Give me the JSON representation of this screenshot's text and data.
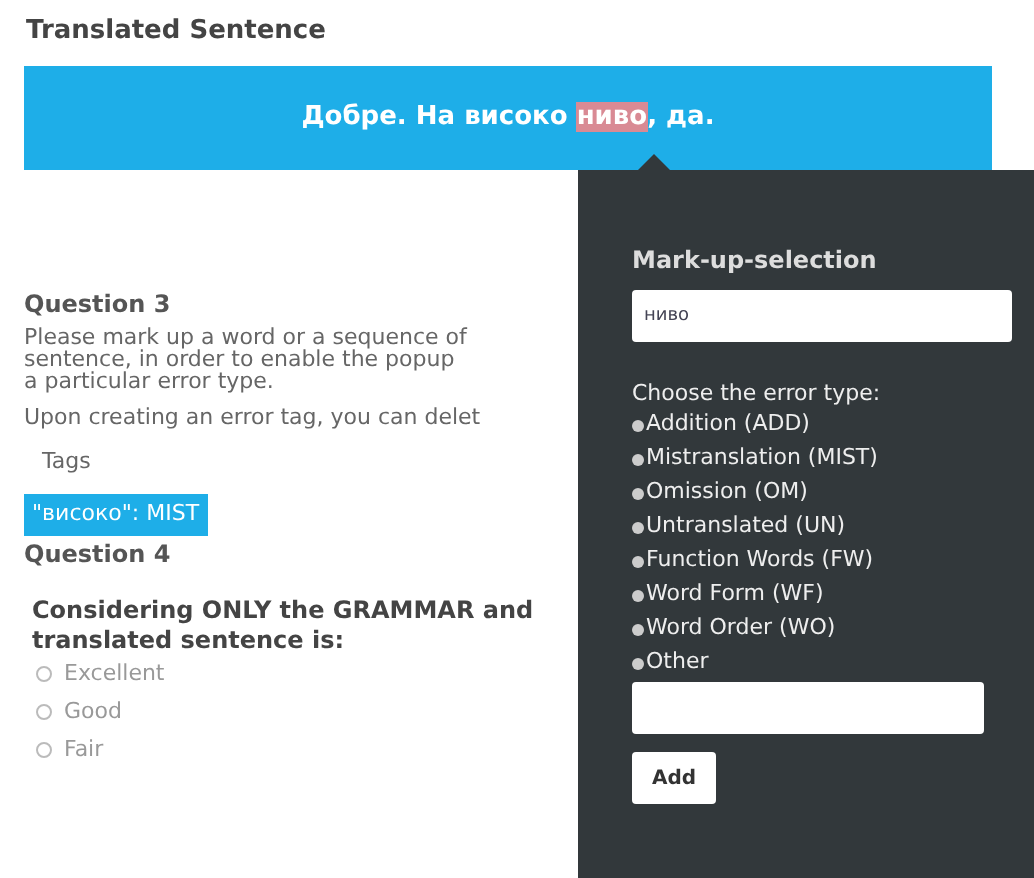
{
  "translated_sentence": {
    "title": "Translated Sentence",
    "parts": [
      {
        "text": "Добре. На високо ",
        "highlighted": false
      },
      {
        "text": "ниво",
        "highlighted": true
      },
      {
        "text": ", да.",
        "highlighted": false
      }
    ]
  },
  "question_3": {
    "title": "Question 3",
    "instruction_lines": [
      "Please mark up a word or a sequence of",
      "sentence, in order to enable the popup",
      "a particular error type."
    ],
    "note": "Upon creating an error tag, you can delet",
    "tags_label": "Tags",
    "tags": [
      "\"високо\": MIST"
    ]
  },
  "question_4": {
    "title": "Question 4",
    "prompt_lines": [
      "Considering ONLY the GRAMMAR and",
      "translated sentence is:"
    ],
    "options": [
      {
        "label": "Excellent",
        "selected": false
      },
      {
        "label": "Good",
        "selected": false
      },
      {
        "label": "Fair",
        "selected": false
      }
    ]
  },
  "popup": {
    "title": "Mark-up-selection",
    "selection_value": "ниво",
    "error_type_label": "Choose the error type:",
    "error_types": [
      {
        "label": "Addition (ADD)",
        "selected": false
      },
      {
        "label": "Mistranslation (MIST)",
        "selected": false
      },
      {
        "label": "Omission (OM)",
        "selected": false
      },
      {
        "label": "Untranslated (UN)",
        "selected": false
      },
      {
        "label": "Function Words (FW)",
        "selected": false
      },
      {
        "label": "Word Form (WF)",
        "selected": false
      },
      {
        "label": "Word Order (WO)",
        "selected": false
      },
      {
        "label": "Other",
        "selected": false
      }
    ],
    "add_button": "Add"
  }
}
